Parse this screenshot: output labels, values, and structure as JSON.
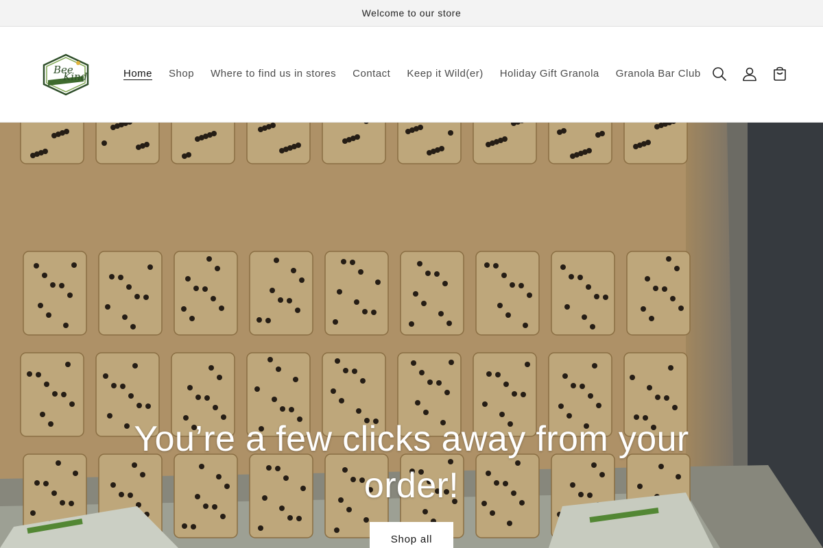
{
  "announcement": {
    "text": "Welcome to our store"
  },
  "header": {
    "logo_text": "Bee Kind",
    "nav": [
      {
        "label": "Home",
        "active": true
      },
      {
        "label": "Shop",
        "active": false
      },
      {
        "label": "Where to find us in stores",
        "active": false
      },
      {
        "label": "Contact",
        "active": false
      },
      {
        "label": "Keep it Wild(er)",
        "active": false
      },
      {
        "label": "Holiday Gift Granola",
        "active": false
      },
      {
        "label": "Granola Bar Club",
        "active": false
      }
    ],
    "icons": [
      "search-icon",
      "account-icon",
      "cart-icon"
    ]
  },
  "hero": {
    "heading": "You’re a few clicks away from your order!",
    "button_label": "Shop all",
    "image_subject": "tray of granola bars"
  },
  "colors": {
    "announcement_bg": "#f3f3f3",
    "logo_green": "#3f6b2e",
    "hero_tan": "#c9a877"
  }
}
